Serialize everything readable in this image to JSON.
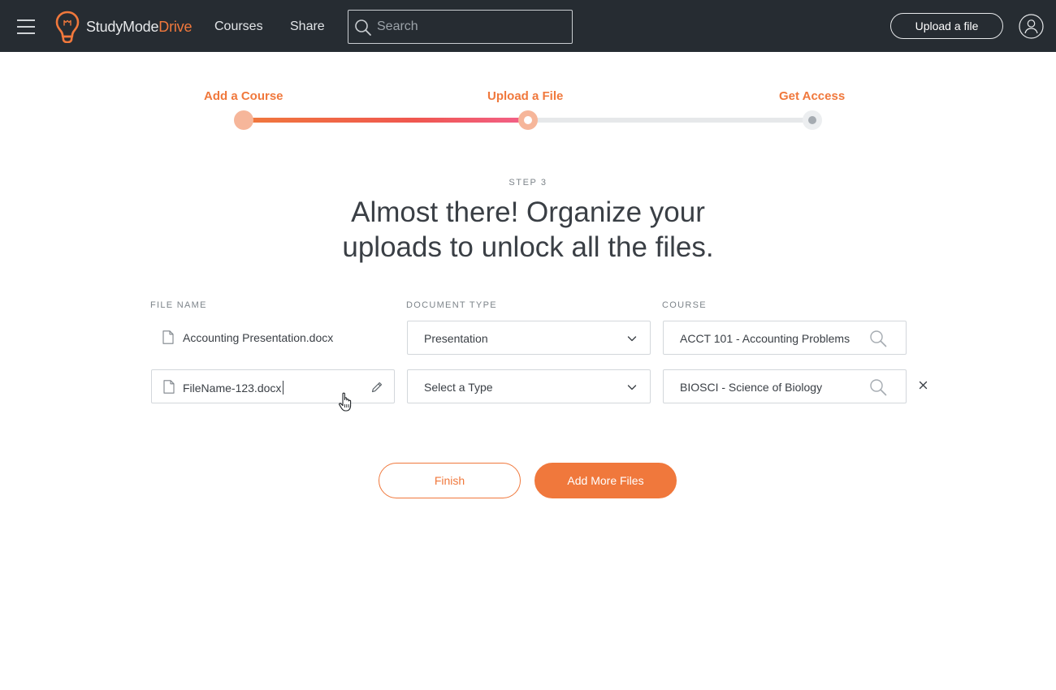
{
  "header": {
    "logo_primary": "StudyMode",
    "logo_accent": "Drive",
    "nav": {
      "courses": "Courses",
      "share": "Share"
    },
    "search": {
      "placeholder": "Search",
      "value": ""
    },
    "upload_button": "Upload a file"
  },
  "progress": {
    "steps": [
      {
        "label": "Add a Course",
        "status": "complete"
      },
      {
        "label": "Upload a File",
        "status": "current"
      },
      {
        "label": "Get Access",
        "status": "upcoming"
      }
    ],
    "completion": 0.5
  },
  "intro": {
    "eyebrow": "STEP 3",
    "heading_line1": "Almost there! Organize your",
    "heading_line2": "uploads to unlock all the files."
  },
  "form": {
    "columns": {
      "file_name": "FILE NAME",
      "document_type": "DOCUMENT TYPE",
      "course": "COURSE"
    },
    "rows": [
      {
        "file_name": "Accounting Presentation.docx",
        "document_type": "Presentation",
        "course": "ACCT 101 - Accounting Problems",
        "editable": false
      },
      {
        "file_name": "FileName-123.docx",
        "document_type": "Select a Type",
        "course": "BIOSCI - Science of Biology",
        "editable": true
      }
    ]
  },
  "actions": {
    "finish": "Finish",
    "add_more": "Add More Files"
  },
  "colors": {
    "accent": "#f0783c",
    "header_bg": "#262c32",
    "gradient_end": "#f2608a",
    "track": "#e6e8ea"
  },
  "icons": {
    "menu": "hamburger-icon",
    "logo": "lightbulb-icon",
    "search": "search-icon",
    "profile": "user-icon",
    "file": "document-icon",
    "dropdown": "chevron-down-icon",
    "lookup": "magnifier-icon",
    "edit": "pencil-icon",
    "remove": "close-icon",
    "pointer": "hand-cursor-icon"
  }
}
